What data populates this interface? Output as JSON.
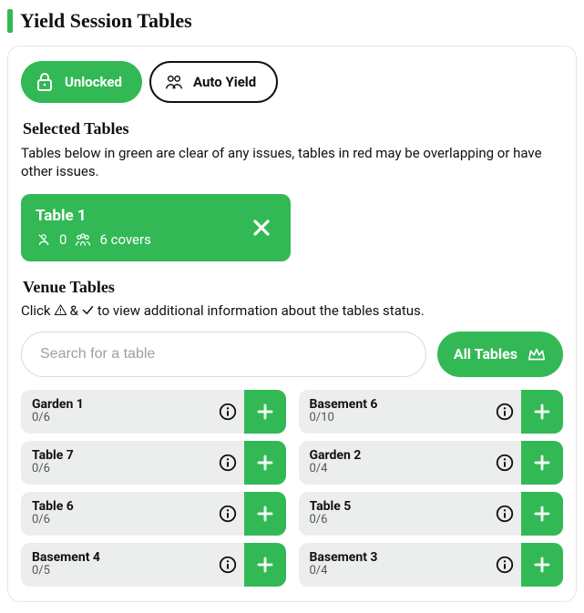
{
  "page": {
    "title": "Yield Session Tables"
  },
  "controls": {
    "lock_label": "Unlocked",
    "auto_yield_label": "Auto Yield"
  },
  "selected_section": {
    "title": "Selected Tables",
    "description": "Tables below in green are clear of any issues, tables in red may be overlapping or have other issues."
  },
  "selected": [
    {
      "name": "Table 1",
      "blocked": "0",
      "covers": "6 covers"
    }
  ],
  "venue_section": {
    "title": "Venue Tables",
    "desc_pre": "Click",
    "desc_mid": "&",
    "desc_post": "to view additional information about the tables status."
  },
  "search": {
    "placeholder": "Search for a table"
  },
  "all_tables_label": "All Tables",
  "venue_left": [
    {
      "name": "Garden 1",
      "cap": "0/6"
    },
    {
      "name": "Table 7",
      "cap": "0/6"
    },
    {
      "name": "Table 6",
      "cap": "0/6"
    },
    {
      "name": "Basement 4",
      "cap": "0/5"
    }
  ],
  "venue_right": [
    {
      "name": "Basement 6",
      "cap": "0/10"
    },
    {
      "name": "Garden 2",
      "cap": "0/4"
    },
    {
      "name": "Table 5",
      "cap": "0/6"
    },
    {
      "name": "Basement 3",
      "cap": "0/4"
    }
  ]
}
